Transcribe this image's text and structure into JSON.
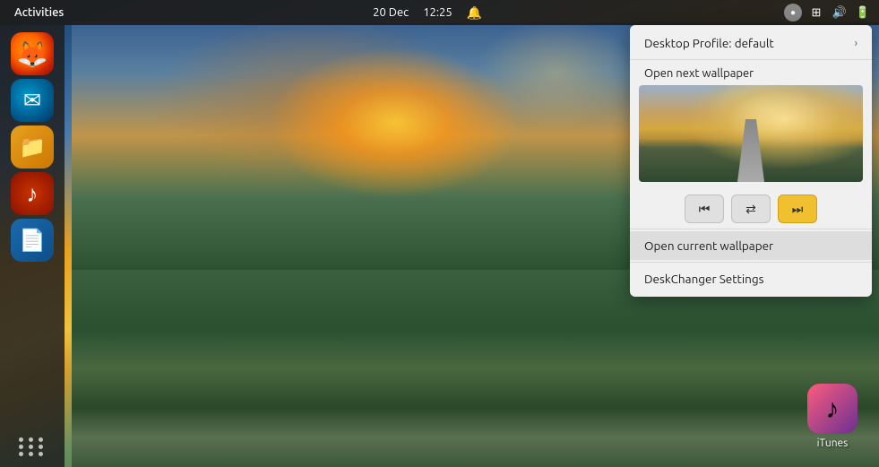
{
  "topbar": {
    "activities_label": "Activities",
    "date": "20 Dec",
    "time": "12:25",
    "notification_icon": "🔔",
    "avatar_icon": "●",
    "network_icon": "⊞",
    "volume_icon": "🔊",
    "battery_icon": "🔋"
  },
  "sidebar": {
    "icons": [
      {
        "id": "firefox",
        "label": "Firefox",
        "class": "firefox-icon"
      },
      {
        "id": "thunderbird",
        "label": "Thunderbird",
        "class": "thunderbird-icon"
      },
      {
        "id": "files",
        "label": "Files",
        "class": "files-icon"
      },
      {
        "id": "rhythmbox",
        "label": "Rhythmbox",
        "class": "rhythmbox-icon"
      },
      {
        "id": "libreoffice",
        "label": "LibreOffice Writer",
        "class": "libreoffice-icon"
      }
    ]
  },
  "desktop_icon": {
    "itunes_label": "iTunes",
    "itunes_emoji": "♪"
  },
  "dropdown": {
    "profile_label": "Desktop Profile: default",
    "next_wallpaper_label": "Open next wallpaper",
    "open_current_label": "Open current wallpaper",
    "settings_label": "DeskChanger Settings",
    "controls": {
      "prev_symbol": "⏮",
      "shuffle_symbol": "⇄",
      "next_symbol": "⏭"
    }
  }
}
